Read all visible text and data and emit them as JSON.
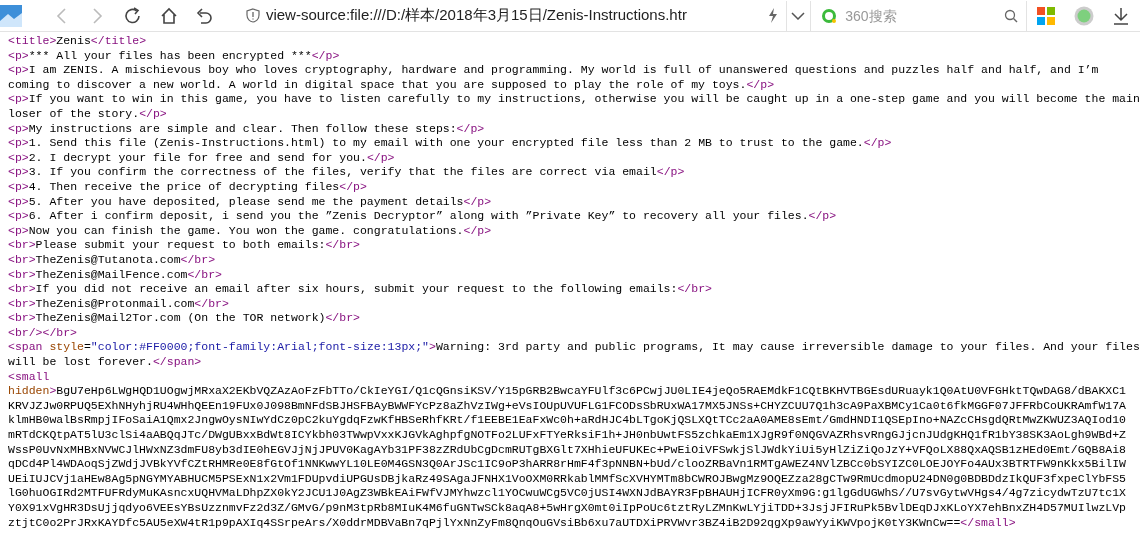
{
  "toolbar": {
    "nav_buttons": [
      {
        "kind": "back",
        "disabled": true
      },
      {
        "kind": "forward",
        "disabled": true
      },
      {
        "kind": "reload",
        "disabled": false
      },
      {
        "kind": "home",
        "disabled": false
      },
      {
        "kind": "undo",
        "disabled": false
      }
    ],
    "address": {
      "url": "view-source:file:///D:/样本/2018年3月15日/Zenis-Instructions.htr"
    },
    "search": {
      "placeholder": "360搜索"
    }
  },
  "source_lines": [
    [
      {
        "kind": "tag",
        "text": "<title>"
      },
      {
        "kind": "text",
        "text": "Zenis"
      },
      {
        "kind": "tag",
        "text": "</title>"
      }
    ],
    [
      {
        "kind": "tag",
        "text": "<p>"
      },
      {
        "kind": "text",
        "text": "*** All your files has been encrypted ***"
      },
      {
        "kind": "tag",
        "text": "</p>"
      }
    ],
    [
      {
        "kind": "tag",
        "text": "<p>"
      },
      {
        "kind": "text",
        "text": "I am ZENIS. A mischievous boy who loves cryptography, hardware and programming. My world is full of unanswered questions and puzzles half and half, and I’m coming to discover a new world. A world in digital space that you are supposed to play the role of my toys."
      },
      {
        "kind": "tag",
        "text": "</p>"
      }
    ],
    [
      {
        "kind": "tag",
        "text": "<p>"
      },
      {
        "kind": "text",
        "text": "If you want to win in this game, you have to listen carefully to my instructions, otherwise you will be caught up in a one-step game and you will become the main loser of the story."
      },
      {
        "kind": "tag",
        "text": "</p>"
      }
    ],
    [
      {
        "kind": "tag",
        "text": "<p>"
      },
      {
        "kind": "text",
        "text": "My instructions are simple and clear. Then follow these steps:"
      },
      {
        "kind": "tag",
        "text": "</p>"
      }
    ],
    [
      {
        "kind": "tag",
        "text": "<p>"
      },
      {
        "kind": "text",
        "text": "1. Send this file (Zenis-Instructions.html) to my email with one your encrypted file less than 2 MB to trust to the game."
      },
      {
        "kind": "tag",
        "text": "</p>"
      }
    ],
    [
      {
        "kind": "tag",
        "text": "<p>"
      },
      {
        "kind": "text",
        "text": "2. I decrypt your file for free and send for you."
      },
      {
        "kind": "tag",
        "text": "</p>"
      }
    ],
    [
      {
        "kind": "tag",
        "text": "<p>"
      },
      {
        "kind": "text",
        "text": "3. If you confirm the correctness of the files, verify that the files are correct via email"
      },
      {
        "kind": "tag",
        "text": "</p>"
      }
    ],
    [
      {
        "kind": "tag",
        "text": "<p>"
      },
      {
        "kind": "text",
        "text": "4. Then receive the price of decrypting files"
      },
      {
        "kind": "tag",
        "text": "</p>"
      }
    ],
    [
      {
        "kind": "tag",
        "text": "<p>"
      },
      {
        "kind": "text",
        "text": "5. After you have deposited, please send me the payment details"
      },
      {
        "kind": "tag",
        "text": "</p>"
      }
    ],
    [
      {
        "kind": "tag",
        "text": "<p>"
      },
      {
        "kind": "text",
        "text": "6. After i confirm deposit, i send you the ”Zenis Decryptor” along with ”Private Key” to recovery all your files."
      },
      {
        "kind": "tag",
        "text": "</p>"
      }
    ],
    [
      {
        "kind": "tag",
        "text": "<p>"
      },
      {
        "kind": "text",
        "text": "Now you can finish the game. You won the game. congratulations."
      },
      {
        "kind": "tag",
        "text": "</p>"
      }
    ],
    [
      {
        "kind": "tag",
        "text": "<br>"
      },
      {
        "kind": "text",
        "text": "Please submit your request to both emails:"
      },
      {
        "kind": "tag",
        "text": "</br>"
      }
    ],
    [
      {
        "kind": "tag",
        "text": "<br>"
      },
      {
        "kind": "text",
        "text": "TheZenis@Tutanota.com"
      },
      {
        "kind": "tag",
        "text": "</br>"
      }
    ],
    [
      {
        "kind": "tag",
        "text": "<br>"
      },
      {
        "kind": "text",
        "text": "TheZenis@MailFence.com"
      },
      {
        "kind": "tag",
        "text": "</br>"
      }
    ],
    [
      {
        "kind": "tag",
        "text": "<br>"
      },
      {
        "kind": "text",
        "text": "If you did not receive an email after six hours, submit your request to the following emails:"
      },
      {
        "kind": "tag",
        "text": "</br>"
      }
    ],
    [
      {
        "kind": "tag",
        "text": "<br>"
      },
      {
        "kind": "text",
        "text": "TheZenis@Protonmail.com"
      },
      {
        "kind": "tag",
        "text": "</br>"
      }
    ],
    [
      {
        "kind": "tag",
        "text": "<br>"
      },
      {
        "kind": "text",
        "text": "TheZenis@Mail2Tor.com (On the TOR network)"
      },
      {
        "kind": "tag",
        "text": "</br>"
      }
    ],
    [
      {
        "kind": "tag",
        "text": "<br/></br>"
      }
    ],
    [
      {
        "kind": "tag",
        "text": "<span "
      },
      {
        "kind": "attr",
        "text": "style"
      },
      {
        "kind": "text",
        "text": "="
      },
      {
        "kind": "value",
        "text": "\"color:#FF0000;font-family:Arial;font-size:13px;\""
      },
      {
        "kind": "tag",
        "text": ">"
      },
      {
        "kind": "text",
        "text": "Warning: 3rd party and public programs, It may cause irreversible damage to your files. And your files will be lost forever."
      },
      {
        "kind": "tag",
        "text": "</span>"
      }
    ],
    [
      {
        "kind": "tag",
        "text": "<small"
      }
    ],
    [
      {
        "kind": "attr",
        "text": "hidden"
      },
      {
        "kind": "tag",
        "text": ">"
      },
      {
        "kind": "text",
        "text": "BgU7eHp6LWgHQD1UOgwjMRxaX2EKbVQZAzAoFzFbTTo/CkIeYGI/Q1cQGnsiKSV/Y15pGRB2BwcaYFUlf3c6PCwjJU0LIE4jeQo5RAEMdkF1CQtBKHVTBGEsdURuayk1Q0AtU0VFGHktTQwDAG8/dBAKXC1"
      }
    ],
    [
      {
        "kind": "text",
        "text": "KRVJZJw0RPUQ5EXhNHyhjRU4WHhQEEn19FUx0J098BmNFdSBJHSFBAyBWWFYcPz8aZhVzIWg+eVsIOUpUVUFLG1FCODsSbRUxWA17MX5JNSs+CHYZCUU7Q1h3cA9PaXBMCy1Ca0t6fkMGGF07JFFRbCoUKRAmfW17A"
      }
    ],
    [
      {
        "kind": "text",
        "text": "klmHB0walBsRmpjIFoSaiA1Qmx2JngwOysNIwYdCz0pC2kuYgdqFzwKfHBSeRhfKRt/f1EEBE1EaFxWc0h+aRdHJC4bLTgoKjQSLXQtTCc2aA0AME8sEmt/GmdHNDI1QSEpIno+NAZcCHsgdQRtMwZKWUZ3AQIod10"
      }
    ],
    [
      {
        "kind": "text",
        "text": "mRTdCKQtpAT5lU3clSi4aABQqJTc/DWgUBxxBdWt8ICYkbh03TWwpVxxKJGVkAghpfgNOTFo2LUFxFTYeRksiF1h+JH0nbUwtFS5zchkaEm1XJgR9f0NQGVAZRhsvRngGJjcnJUdgKHQ1fR1bY38SK3AoLgh9WBd+Z"
      }
    ],
    [
      {
        "kind": "text",
        "text": "WssP0UvNxMHBxNVWCJlHWxNZ3dmFU8yb3dIE0hEGVJjNjJPUV0KagAYb31PF38zZRdUbCgDcmRUTgBXGlt7XHhieUFUKEc+PwEiOiVFSwkjSlJWdkYiUi5yHlZiZiQoJzY+VFQoLX88QxAQSB1zHEd0Emt/GQB8Ai8"
      }
    ],
    [
      {
        "kind": "text",
        "text": "qDCd4Pl4WDAoqSjZWdjJVBkYVfCZtRHMRe0E8fGtOf1NNKwwYL10LE0M4GSN3Q0ArJSc1IC9oP3hARR8rHmF4f3pNNBN+bUd/clooZRBaVn1RMTgAWEZ4NVlZBCc0bSYIZC0LOEJOYFo4AUx3BTRTFW9nKkx5BilIW"
      }
    ],
    [
      {
        "kind": "text",
        "text": "UEiIUJCVj1aHEw8Ag5pNGYMYABHUCM5PSExN1x2Vm1FDUpvdiUPGUsDBjkaRz49SAgaJFNHX1VoOXM0RRkablMMfScXVHYMTm8bCWROJBwgMz9OQEZza28gCTw9RmUcdmopU24DN0g0BDBDdzIkQUF3fxpeClYbFS5"
      }
    ],
    [
      {
        "kind": "text",
        "text": "lG0huOGIRd2MTFUFRdyMuKAsncxUQHVMaLDhpZX0kY2JCU1J0AgZ3WBkEAiFWfVJMYhwzcl1YOCwuWCg5VC0jUSI4WXNJdBAYR3FpBHAUHjICFR0yXm9G:g1lgGdUGWhS//U7svGytwVHgs4/4g7zicydwTzU7tc1X"
      }
    ],
    [
      {
        "kind": "text",
        "text": "Y0X91xVgHR3DsUjjqdyo6VEEsYBsUzznmvFz2d3Z/GMvG/p9nM3tpRb8MIuK4M6fuGNTwSCk8aqA8+5wHrgX0mt0iIpPoUc6tztRyLZMnKwLYjiTDD+3JsjJFIRuPk5BvlDEqDJxKLoYX7ehBnxZH4D57MUIlwzLVp"
      }
    ],
    [
      {
        "kind": "text",
        "text": "ztjtC0o2PrJRxKAYDfc5AU5eXW4tR1p9pAXIq4SSrpeArs/X0ddrMDBVaBn7qPjlYxNnZyFm8QnqOuGVsiBb6xu7aUTDXiPRVWvr3BZ4iB2D92qgXp9awYyiKWVpojK0tY3KWnCw=="
      },
      {
        "kind": "tag",
        "text": "</small>"
      }
    ]
  ]
}
